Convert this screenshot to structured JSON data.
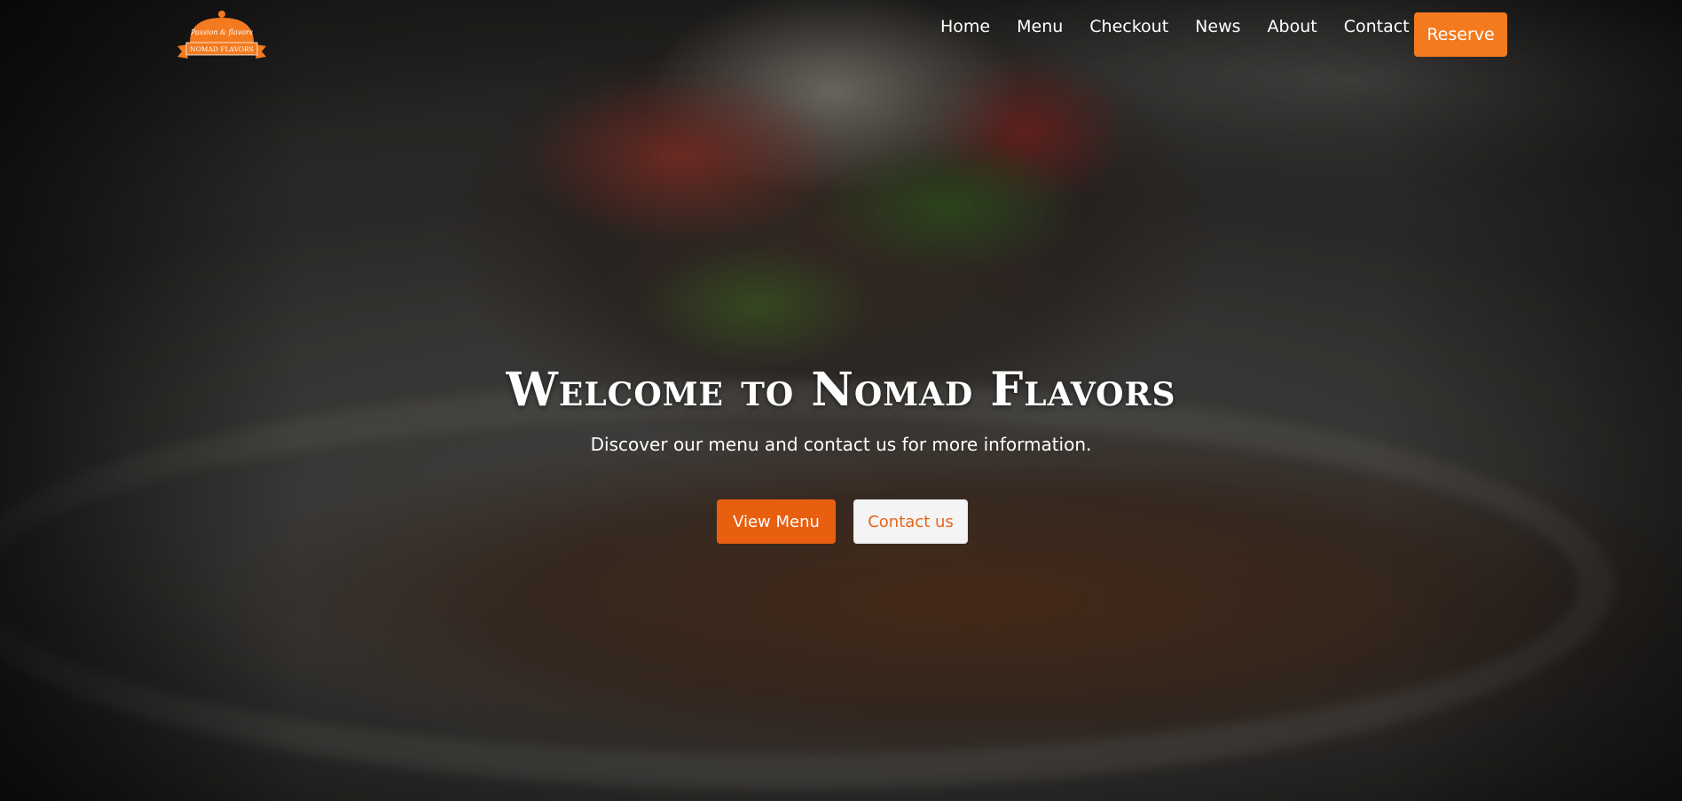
{
  "logo": {
    "tagline": "Passion & flavors",
    "name": "NOMAD FLAVORS",
    "color": "#f47a1f"
  },
  "nav": {
    "items": [
      {
        "label": "Home"
      },
      {
        "label": "Menu"
      },
      {
        "label": "Checkout"
      },
      {
        "label": "News"
      },
      {
        "label": "About"
      },
      {
        "label": "Contact"
      }
    ],
    "reserve_label": "Reserve"
  },
  "hero": {
    "title": "Welcome to Nomad Flavors",
    "subtitle": "Discover our menu and contact us for more information.",
    "primary_button": "View Menu",
    "secondary_button": "Contact us"
  },
  "colors": {
    "accent": "#f47a1f",
    "primary_button": "#e85f10",
    "secondary_button_bg": "#f4f4f4",
    "secondary_button_text": "#e8641a"
  }
}
